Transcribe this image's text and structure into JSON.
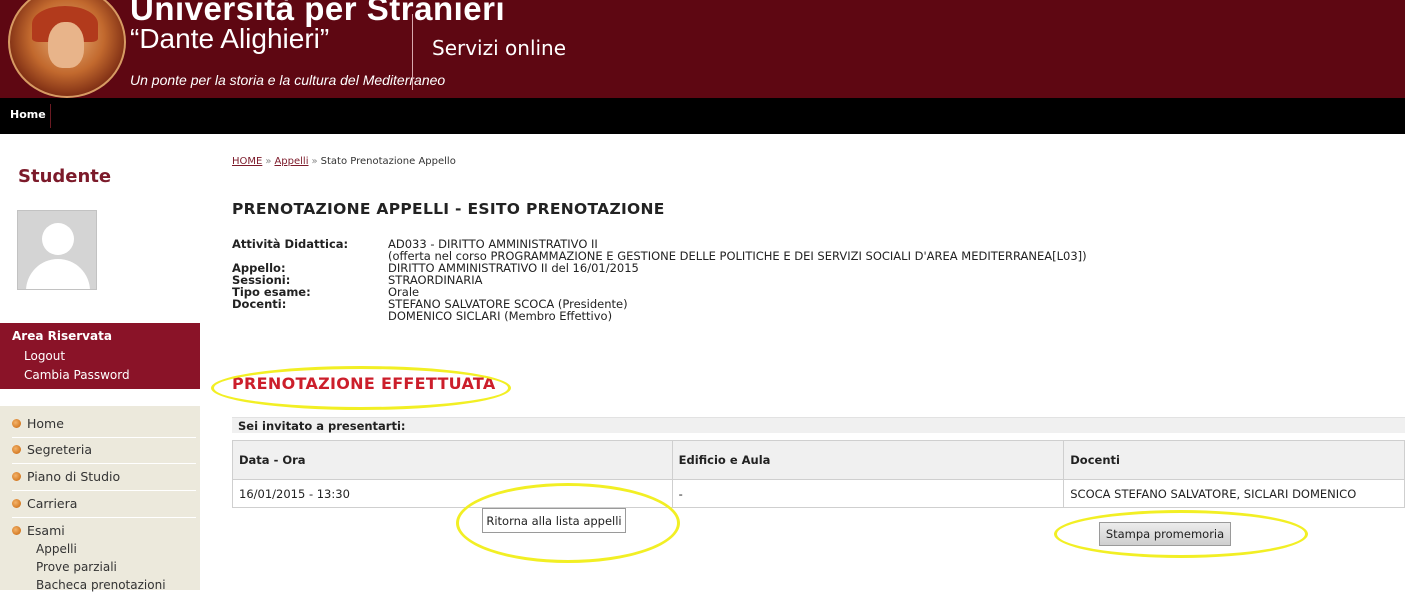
{
  "header": {
    "university_title": "Università per Stranieri",
    "university_subtitle": "“Dante Alighieri”",
    "motto": "Un ponte per la storia e la cultura del Mediterraneo",
    "services_label": "Servizi online",
    "background_color": "#5e0712"
  },
  "navbar": {
    "home_label": "Home"
  },
  "sidebar": {
    "section_title": "Studente",
    "area_riservata": {
      "title": "Area Riservata",
      "links": [
        "Logout",
        "Cambia Password"
      ]
    },
    "menu": {
      "items": [
        "Home",
        "Segreteria",
        "Piano di Studio",
        "Carriera",
        "Esami"
      ],
      "esami_subitems": [
        "Appelli",
        "Prove parziali",
        "Bacheca prenotazioni"
      ]
    }
  },
  "breadcrumb": {
    "home": "HOME",
    "appelli": "Appelli",
    "current": "Stato Prenotazione Appello",
    "separator": "»"
  },
  "page": {
    "title": "PRENOTAZIONE APPELLI - ESITO PRENOTAZIONE",
    "details": [
      {
        "label": "Attività Didattica:",
        "value": "AD033 - DIRITTO AMMINISTRATIVO II"
      },
      {
        "label": "",
        "value": "(offerta nel corso PROGRAMMAZIONE E GESTIONE DELLE POLITICHE E DEI SERVIZI SOCIALI D'AREA MEDITERRANEA[L03])"
      },
      {
        "label": "Appello:",
        "value": "DIRITTO AMMINISTRATIVO II del 16/01/2015"
      },
      {
        "label": "Sessioni:",
        "value": "STRAORDINARIA"
      },
      {
        "label": "Tipo esame:",
        "value": "Orale"
      },
      {
        "label": "Docenti:",
        "value": "STEFANO SALVATORE SCOCA (Presidente)"
      },
      {
        "label": "",
        "value": "DOMENICO SICLARI (Membro Effettivo)"
      }
    ],
    "result_status": "PRENOTAZIONE EFFETTUATA",
    "invitation_label": "Sei invitato a presentarti:",
    "table": {
      "headers": [
        "Data - Ora",
        "Edificio e Aula",
        "Docenti"
      ],
      "rows": [
        [
          "16/01/2015 - 13:30",
          "-",
          "SCOCA STEFANO SALVATORE, SICLARI DOMENICO"
        ]
      ]
    },
    "buttons": {
      "back": "Ritorna alla lista appelli",
      "print": "Stampa promemoria"
    }
  },
  "colors": {
    "accent": "#8a1328",
    "status_red": "#cc1e2b",
    "highlight_yellow": "#f2ef24"
  }
}
